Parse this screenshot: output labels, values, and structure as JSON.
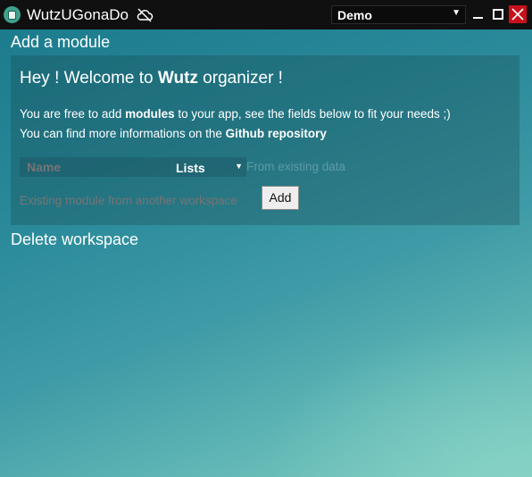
{
  "titlebar": {
    "app_title": "WutzUGonaDo",
    "workspace_selected": "Demo",
    "icons": [
      "app-logo-icon",
      "cloud-off-icon",
      "chevron-down-icon",
      "minimize-icon",
      "maximize-icon",
      "close-icon"
    ]
  },
  "main": {
    "add_module_title": "Add a module",
    "welcome_prefix": "Hey ! Welcome to ",
    "welcome_bold": "Wutz",
    "welcome_suffix": " organizer !",
    "desc1_prefix": "You are free to add ",
    "desc1_bold": "modules",
    "desc1_suffix": " to your app, see the fields below to fit your needs ;)",
    "desc2_prefix": "You can find more informations on the ",
    "desc2_bold": "Github repository",
    "name_placeholder": "Name",
    "module_type_selected": "Lists",
    "from_existing_label": "From existing data",
    "existing_placeholder": "Existing module from another workspace",
    "add_button": "Add",
    "delete_workspace_title": "Delete workspace"
  },
  "colors": {
    "titlebar_bg": "#101010",
    "close_button_bg": "#c8101a",
    "background_start": "#1a7a8c",
    "background_end": "#80cdc2"
  }
}
